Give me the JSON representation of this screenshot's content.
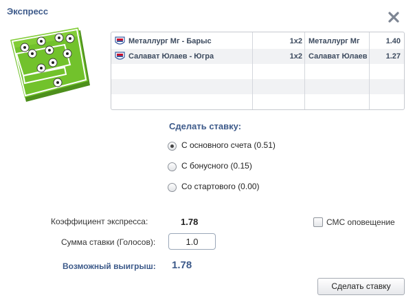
{
  "dialog": {
    "title": "Экспресс"
  },
  "icons": {
    "close": "close-icon",
    "logo": "soccer-field-icon",
    "league": "khl-logo-icon"
  },
  "matches": [
    {
      "teams": "Металлург Мг - Барыс",
      "market": "1х2",
      "pick": "Металлург Мг",
      "odds": "1.40"
    },
    {
      "teams": "Салават Юлаев - Югра",
      "market": "1х2",
      "pick": "Салават Юлаев",
      "odds": "1.27"
    }
  ],
  "bet_source": {
    "title": "Сделать ставку:",
    "options": [
      {
        "label": "С основного счета (0.51)",
        "selected": true
      },
      {
        "label": "С бонусного (0.15)",
        "selected": false
      },
      {
        "label": "Со стартового (0.00)",
        "selected": false
      }
    ]
  },
  "summary": {
    "coef_label": "Коэффициент экспресса:",
    "coef_value": "1.78",
    "stake_label": "Сумма ставки (Голосов):",
    "stake_value": "1.0",
    "win_label": "Возможный выигрыш:",
    "win_value": "1.78"
  },
  "sms": {
    "label": "СМС оповещение",
    "checked": false
  },
  "submit": {
    "label": "Сделать ставку"
  },
  "colors": {
    "accent": "#3d5a8a",
    "grass": "#6cbb2a",
    "grid_border": "#c6c9cf"
  }
}
